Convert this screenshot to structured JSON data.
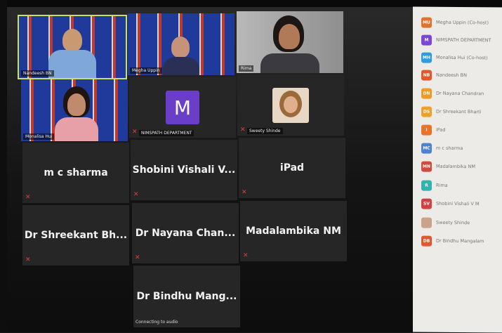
{
  "video_tiles": [
    {
      "label": "Nandeesh BN"
    },
    {
      "label": "Megha Uppin"
    },
    {
      "label": "Rima"
    },
    {
      "label": "Monalisa Hui"
    },
    {
      "label": "NIMSPATH DEPARTMENT",
      "avatar_letter": "M"
    },
    {
      "label": "Sweety Shinde"
    }
  ],
  "name_tiles": [
    {
      "label": "m c sharma"
    },
    {
      "label": "Shobini Vishali V..."
    },
    {
      "label": "iPad"
    },
    {
      "label": "Dr Shreekant Bh..."
    },
    {
      "label": "Dr Nayana Chan..."
    },
    {
      "label": "Madalambika NM"
    },
    {
      "label": "Dr Bindhu Mang..."
    }
  ],
  "connecting_text": "Connecting to audio",
  "participants": [
    {
      "initials": "MU",
      "name": "Megha Uppin (Co-host)",
      "color": "#e0732c"
    },
    {
      "initials": "M",
      "name": "NIMSPATH DEPARTMENT",
      "color": "#7a48d1"
    },
    {
      "initials": "MH",
      "name": "Monalisa Hui (Co-host)",
      "color": "#2e9ed8"
    },
    {
      "initials": "NB",
      "name": "Nandeesh BN",
      "color": "#e0582c"
    },
    {
      "initials": "DN",
      "name": "Dr Nayana Chandran",
      "color": "#ef9a23"
    },
    {
      "initials": "DS",
      "name": "Dr Shreekant Bharti",
      "color": "#efa02a"
    },
    {
      "initials": "I",
      "name": "iPad",
      "color": "#e8742c"
    },
    {
      "initials": "MC",
      "name": "m c sharma",
      "color": "#4c82d0"
    },
    {
      "initials": "MN",
      "name": "Madalambika NM",
      "color": "#d24a3a"
    },
    {
      "initials": "R",
      "name": "Rima",
      "color": "#31b3b0"
    },
    {
      "initials": "SV",
      "name": "Shobini Vishali V M",
      "color": "#d24040"
    },
    {
      "initials": "",
      "name": "Sweety Shinde",
      "color": "#c9a48a"
    },
    {
      "initials": "DB",
      "name": "Dr Bindhu Mangalam",
      "color": "#e0582c"
    }
  ]
}
